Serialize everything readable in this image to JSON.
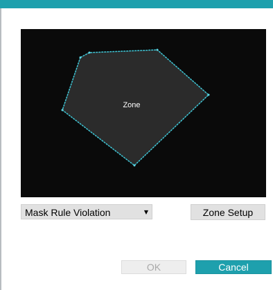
{
  "window": {
    "accent_color": "#1ea0ad"
  },
  "canvas": {
    "background": "#0a0a0a",
    "zone": {
      "label": "Zone",
      "fill_color": "#2b2b2b",
      "edge_color": "#3fc6d6"
    }
  },
  "rule_select": {
    "selected": "Mask Rule Violation",
    "arrow_icon": "chevron-down-icon"
  },
  "buttons": {
    "zone_setup": "Zone Setup",
    "ok": "OK",
    "ok_enabled": false,
    "cancel": "Cancel"
  }
}
